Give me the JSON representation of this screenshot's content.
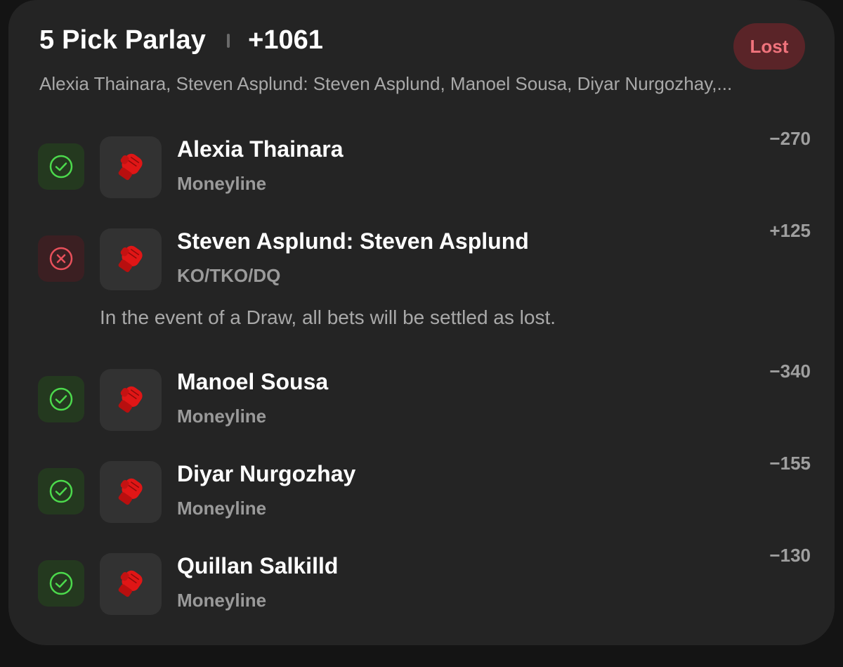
{
  "parlay": {
    "title": "5 Pick Parlay",
    "odds": "+1061",
    "status": "Lost",
    "summary": "Alexia Thainara, Steven Asplund: Steven Asplund, Manoel Sousa, Diyar Nurgozhay,..."
  },
  "legs": [
    {
      "name": "Alexia Thainara",
      "market": "Moneyline",
      "odds": "−270",
      "result": "win",
      "icon": "check-circle-icon"
    },
    {
      "name": "Steven Asplund: Steven Asplund",
      "market": "KO/TKO/DQ",
      "odds": "+125",
      "result": "loss",
      "icon": "x-circle-icon"
    },
    {
      "name": "Manoel Sousa",
      "market": "Moneyline",
      "odds": "−340",
      "result": "win",
      "icon": "check-circle-icon"
    },
    {
      "name": "Diyar Nurgozhay",
      "market": "Moneyline",
      "odds": "−155",
      "result": "win",
      "icon": "check-circle-icon"
    },
    {
      "name": "Quillan Salkilld",
      "market": "Moneyline",
      "odds": "−130",
      "result": "win",
      "icon": "check-circle-icon"
    }
  ],
  "note": "In the event of a Draw, all bets will be settled as lost.",
  "colors": {
    "win": "#4cd94c",
    "loss": "#e8505b",
    "glove": "#e01616"
  }
}
